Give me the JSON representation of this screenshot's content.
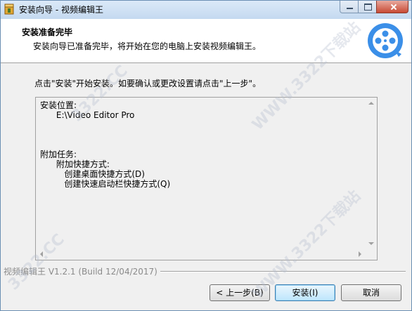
{
  "window": {
    "title": "安装向导 - 视频编辑王",
    "icons": {
      "app": "installer-box-icon",
      "minimize": "minimize-icon",
      "maximize": "maximize-icon",
      "close": "close-icon"
    }
  },
  "header": {
    "title": "安装准备完毕",
    "subtitle": "安装向导已准备完毕，将开始在您的电脑上安装视频编辑王。",
    "logo_icon": "film-reel-icon"
  },
  "instruction": "点击\"安装\"开始安装。如要确认或更改设置请点击\"上一步\"。",
  "memo": {
    "lines": [
      "安装位置:",
      "      E:\\Video Editor Pro",
      "",
      "",
      "",
      "附加任务:",
      "      附加快捷方式:",
      "         创建桌面快捷方式(D)",
      "         创建快速启动栏快捷方式(Q)"
    ]
  },
  "version_label": "视频编辑王 V1.2.1  (Build 12/04/2017)",
  "buttons": {
    "back": "< 上一步(B)",
    "install": "安装(I)",
    "cancel": "取消"
  },
  "watermark": {
    "text": "WWW.3322下载站",
    "short": "3322.CC"
  },
  "colors": {
    "accent": "#3c7fb1",
    "logo_blue": "#3b8fe8",
    "header_bg": "#ffffff",
    "window_bg": "#f0f0f0"
  }
}
